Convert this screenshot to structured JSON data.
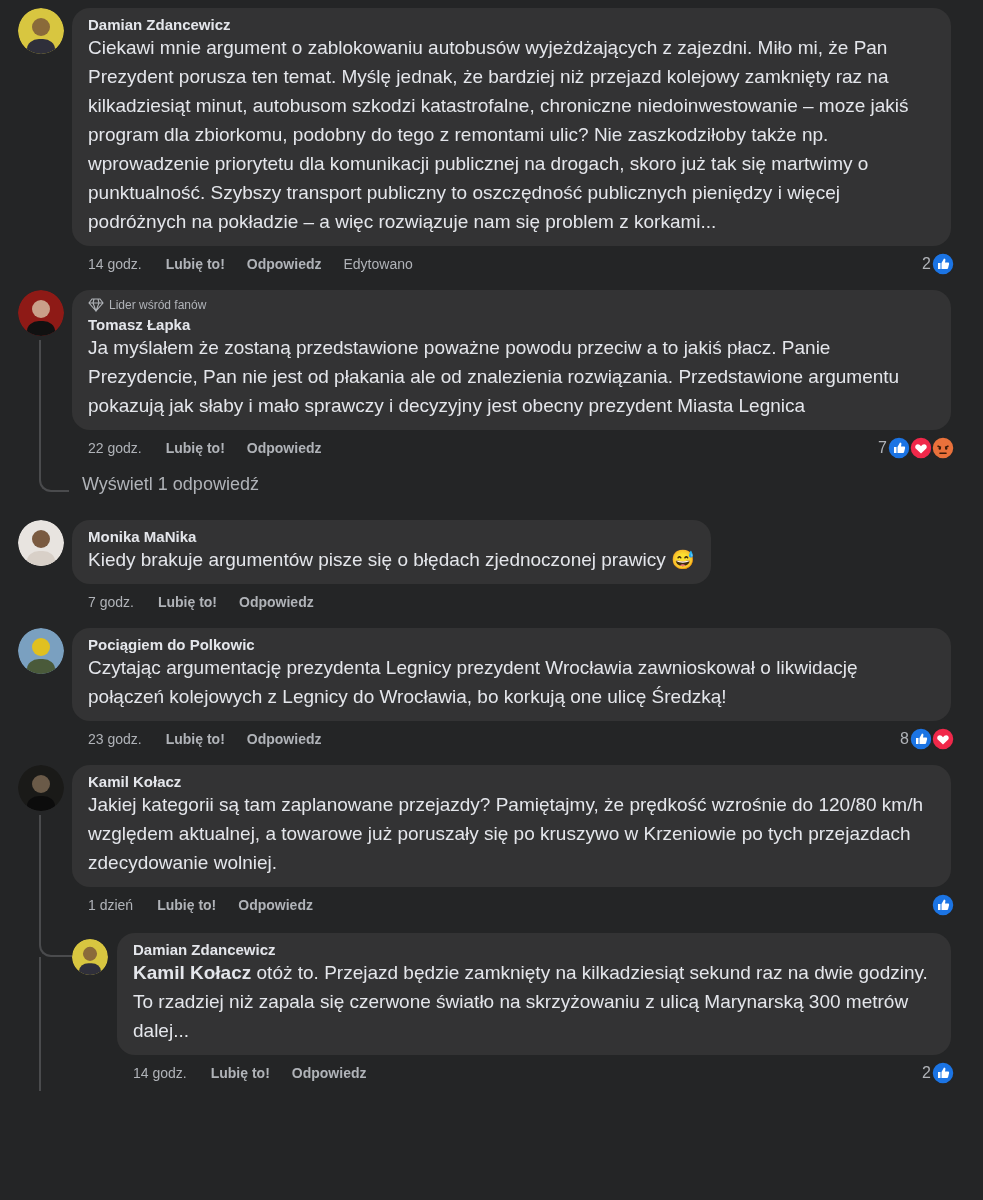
{
  "comments": [
    {
      "author": "Damian Zdancewicz",
      "body": "Ciekawi mnie argument o zablokowaniu autobusów wyjeżdżających z zajezdni. Miło mi, że Pan Prezydent porusza ten temat. Myślę jednak, że bardziej niż przejazd kolejowy zamknięty raz na kilkadziesiąt minut, autobusom szkodzi katastrofalne, chroniczne niedoinwestowanie – moze jakiś program dla zbiorkomu, podobny do tego z remontami ulic? Nie zaszkodziłoby także np. wprowadzenie priorytetu dla komunikacji publicznej na drogach, skoro już tak się martwimy o punktualność. Szybszy transport publiczny to oszczędność publicznych pieniędzy i więcej podróżnych na pokładzie – a więc rozwiązuje nam się problem z korkami...",
      "time": "14 godz.",
      "like": "Lubię to!",
      "reply": "Odpowiedz",
      "edited": "Edytowano",
      "reaction_count": "2",
      "reactions": [
        {
          "kind": "like"
        }
      ]
    },
    {
      "badge": "Lider wśród fanów",
      "author": "Tomasz Łapka",
      "body": "Ja myślałem że zostaną przedstawione poważne powodu przeciw a to jakiś płacz. Panie Prezydencie, Pan nie jest od płakania ale od znalezienia rozwiązania. Przedstawione argumentu pokazują jak słaby i mało sprawczy i decyzyjny jest obecny prezydent Miasta Legnica",
      "time": "22 godz.",
      "like": "Lubię to!",
      "reply": "Odpowiedz",
      "reaction_count": "7",
      "reactions": [
        {
          "kind": "like"
        },
        {
          "kind": "love"
        },
        {
          "kind": "angry"
        }
      ],
      "view_replies": "Wyświetl 1 odpowiedź"
    },
    {
      "author": "Monika MaNika",
      "body": "Kiedy brakuje argumentów pisze się o błędach zjednoczonej prawicy 😅",
      "time": "7 godz.",
      "like": "Lubię to!",
      "reply": "Odpowiedz"
    },
    {
      "author": "Pociągiem do Polkowic",
      "body": "Czytając argumentację prezydenta Legnicy prezydent Wrocławia zawnioskował o likwidację połączeń kolejowych z Legnicy do Wrocławia, bo korkują one ulicę Średzką!",
      "time": "23 godz.",
      "like": "Lubię to!",
      "reply": "Odpowiedz",
      "reaction_count": "8",
      "reactions": [
        {
          "kind": "like"
        },
        {
          "kind": "love"
        }
      ]
    },
    {
      "author": "Kamil Kołacz",
      "body": "Jakiej kategorii są tam zaplanowane przejazdy? Pamiętajmy, że prędkość wzrośnie do 120/80 km/h względem aktualnej, a towarowe już poruszały się po kruszywo w Krzeniowie po tych przejazdach zdecydowanie wolniej.",
      "time": "1 dzień",
      "like": "Lubię to!",
      "reply": "Odpowiedz",
      "reactions": [
        {
          "kind": "like"
        }
      ],
      "children": [
        {
          "author": "Damian Zdancewicz",
          "body": "**Kamil Kołacz** otóż to. Przejazd będzie zamknięty na kilkadziesiąt sekund raz na dwie godziny. To rzadziej niż zapala się czerwone światło na skrzyżowaniu z ulicą Marynarską 300 metrów dalej...",
          "time": "14 godz.",
          "like": "Lubię to!",
          "reply": "Odpowiedz",
          "reaction_count": "2",
          "reactions": [
            {
              "kind": "like"
            }
          ]
        }
      ]
    }
  ]
}
